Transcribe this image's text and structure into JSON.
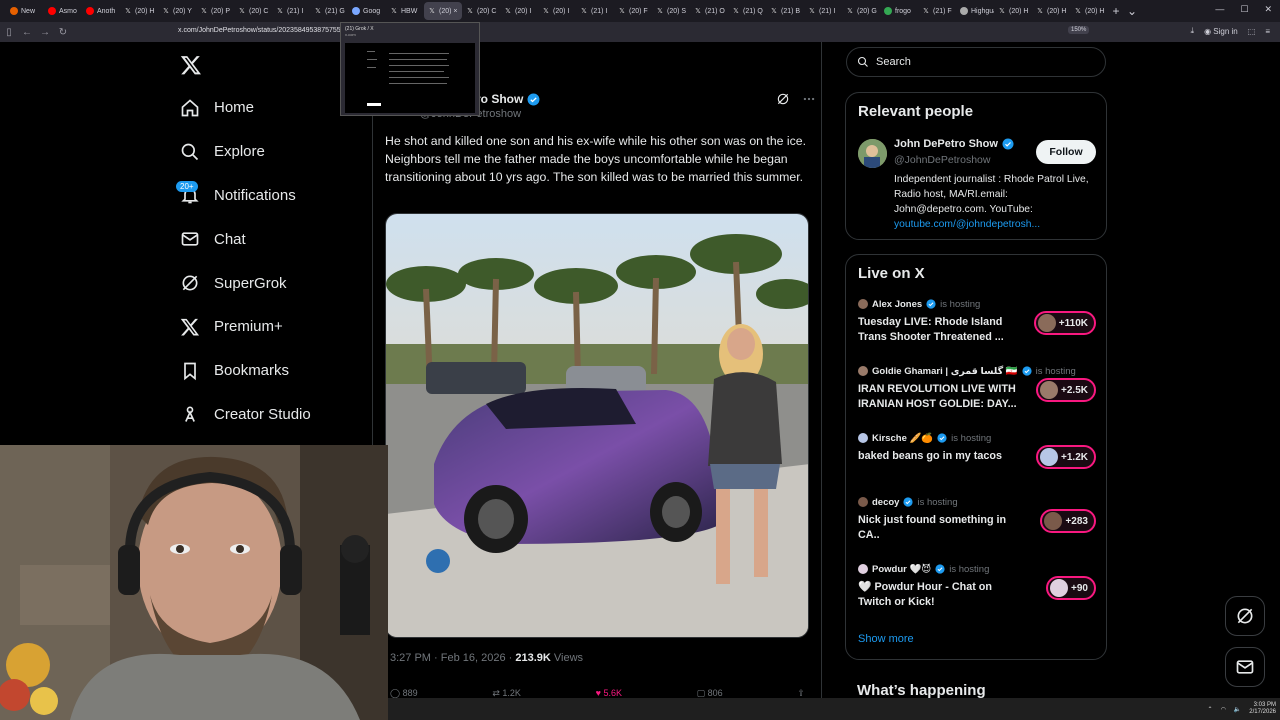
{
  "browser": {
    "tabs": [
      {
        "label": "New",
        "icon": "firefox-icon",
        "color": "#e66000"
      },
      {
        "label": "Asmo",
        "icon": "youtube-icon",
        "color": "#ff0000"
      },
      {
        "label": "Anoth",
        "icon": "youtube-icon",
        "color": "#ff0000"
      },
      {
        "label": "(20) H",
        "icon": "x-icon",
        "color": "#ffffff"
      },
      {
        "label": "(20) Y",
        "icon": "x-icon",
        "color": "#ffffff"
      },
      {
        "label": "(20) P",
        "icon": "x-icon",
        "color": "#ffffff"
      },
      {
        "label": "(20) C",
        "icon": "x-icon",
        "color": "#ffffff"
      },
      {
        "label": "(21) I",
        "icon": "x-icon",
        "color": "#ffffff"
      },
      {
        "label": "(21) G",
        "icon": "x-icon",
        "color": "#ffffff"
      },
      {
        "label": "Goog",
        "icon": "grok-icon",
        "color": "#7aa7ff"
      },
      {
        "label": "HBW",
        "icon": "x-icon",
        "color": "#ffffff"
      },
      {
        "label": "(20) ×",
        "icon": "x-icon",
        "color": "#ffffff",
        "active": true
      },
      {
        "label": "(20) C",
        "icon": "x-icon",
        "color": "#ffffff"
      },
      {
        "label": "(20) I",
        "icon": "x-icon",
        "color": "#ffffff"
      },
      {
        "label": "(20) I",
        "icon": "x-icon",
        "color": "#ffffff"
      },
      {
        "label": "(21) I",
        "icon": "x-icon",
        "color": "#ffffff"
      },
      {
        "label": "(20) F",
        "icon": "x-icon",
        "color": "#ffffff"
      },
      {
        "label": "(20) S",
        "icon": "x-icon",
        "color": "#ffffff"
      },
      {
        "label": "(21) O",
        "icon": "x-icon",
        "color": "#ffffff"
      },
      {
        "label": "(21) Q",
        "icon": "x-icon",
        "color": "#ffffff"
      },
      {
        "label": "(21) B",
        "icon": "x-icon",
        "color": "#ffffff"
      },
      {
        "label": "(21) I",
        "icon": "x-icon",
        "color": "#ffffff"
      },
      {
        "label": "(20) G",
        "icon": "x-icon",
        "color": "#ffffff"
      },
      {
        "label": "frogo",
        "icon": "google-icon",
        "color": "#34a853"
      },
      {
        "label": "(21) F",
        "icon": "x-icon",
        "color": "#ffffff"
      },
      {
        "label": "Highguar",
        "icon": "page-icon",
        "color": "#aaaaaa"
      },
      {
        "label": "(20) H",
        "icon": "x-icon",
        "color": "#ffffff"
      },
      {
        "label": "(20) H",
        "icon": "x-icon",
        "color": "#ffffff"
      },
      {
        "label": "(20) H",
        "icon": "x-icon",
        "color": "#ffffff"
      }
    ],
    "url": "x.com/JohnDePetroshow/status/2023584953875755...",
    "zoom": "150%",
    "sign_in": "Sign in",
    "tab_preview": {
      "title": "(21) Grok / X",
      "site": "x.com"
    }
  },
  "nav": {
    "items": [
      {
        "label": "Home",
        "icon": "home-icon"
      },
      {
        "label": "Explore",
        "icon": "search-icon"
      },
      {
        "label": "Notifications",
        "icon": "bell-icon",
        "badge": "20+"
      },
      {
        "label": "Chat",
        "icon": "mail-icon"
      },
      {
        "label": "SuperGrok",
        "icon": "grok-icon"
      },
      {
        "label": "Premium+",
        "icon": "x-icon"
      },
      {
        "label": "Bookmarks",
        "icon": "bookmark-icon"
      },
      {
        "label": "Creator Studio",
        "icon": "creator-icon"
      }
    ]
  },
  "tweet": {
    "author_name": "ro Show",
    "author_handle": "@JohnDePetroshow",
    "text": "He shot and killed one son and his ex-wife while his other son was on the ice. Neighbors tell me the father made the boys uncomfortable while he began transitioning about 10 yrs ago. The son killed was to be married this summer.",
    "time": "3:27 PM · Feb 16, 2026 · ",
    "views_count": "213.9K",
    "views_label": " Views",
    "actions": {
      "replies": "889",
      "reposts": "1.2K",
      "likes": "5.6K",
      "bookmarks": "806"
    }
  },
  "search": {
    "placeholder": "Search"
  },
  "relevant_people": {
    "title": "Relevant people",
    "name": "John DePetro Show",
    "handle": "@JohnDePetroshow",
    "follow_label": "Follow",
    "bio": "Independent journalist : Rhode Patrol Live, Radio host, MA/RI.email: John@depetro.com. YouTube:",
    "bio_link": "youtube.com/@johndepetrosh..."
  },
  "live": {
    "title": "Live on X",
    "hosting_label": "is hosting",
    "items": [
      {
        "host": "Alex Jones",
        "title": "Tuesday LIVE: Rhode Island Trans Shooter Threatened ...",
        "count": "+110K"
      },
      {
        "host": "Goldie Ghamari | گلسا قمری 🇮🇷",
        "title": "IRAN REVOLUTION LIVE WITH IRANIAN HOST GOLDIE: DAY...",
        "count": "+2.5K"
      },
      {
        "host": "Kirsche 🥖🍊",
        "title": "baked beans go in my tacos",
        "count": "+1.2K"
      },
      {
        "host": "decoy",
        "title": "Nick just found something in CA..",
        "count": "+283"
      },
      {
        "host": "Powdur 🤍😈",
        "title": "🤍 Powdur Hour - Chat on Twitch or Kick!",
        "count": "+90"
      }
    ],
    "show_more": "Show more"
  },
  "whats_happening": "What’s happening",
  "taskbar": {
    "time": "3:03 PM",
    "date": "2/17/2026"
  },
  "colors": {
    "accent": "#1d9bf0",
    "live_ring": "#f91880",
    "background": "#000000",
    "verified": "#1d9bf0"
  }
}
